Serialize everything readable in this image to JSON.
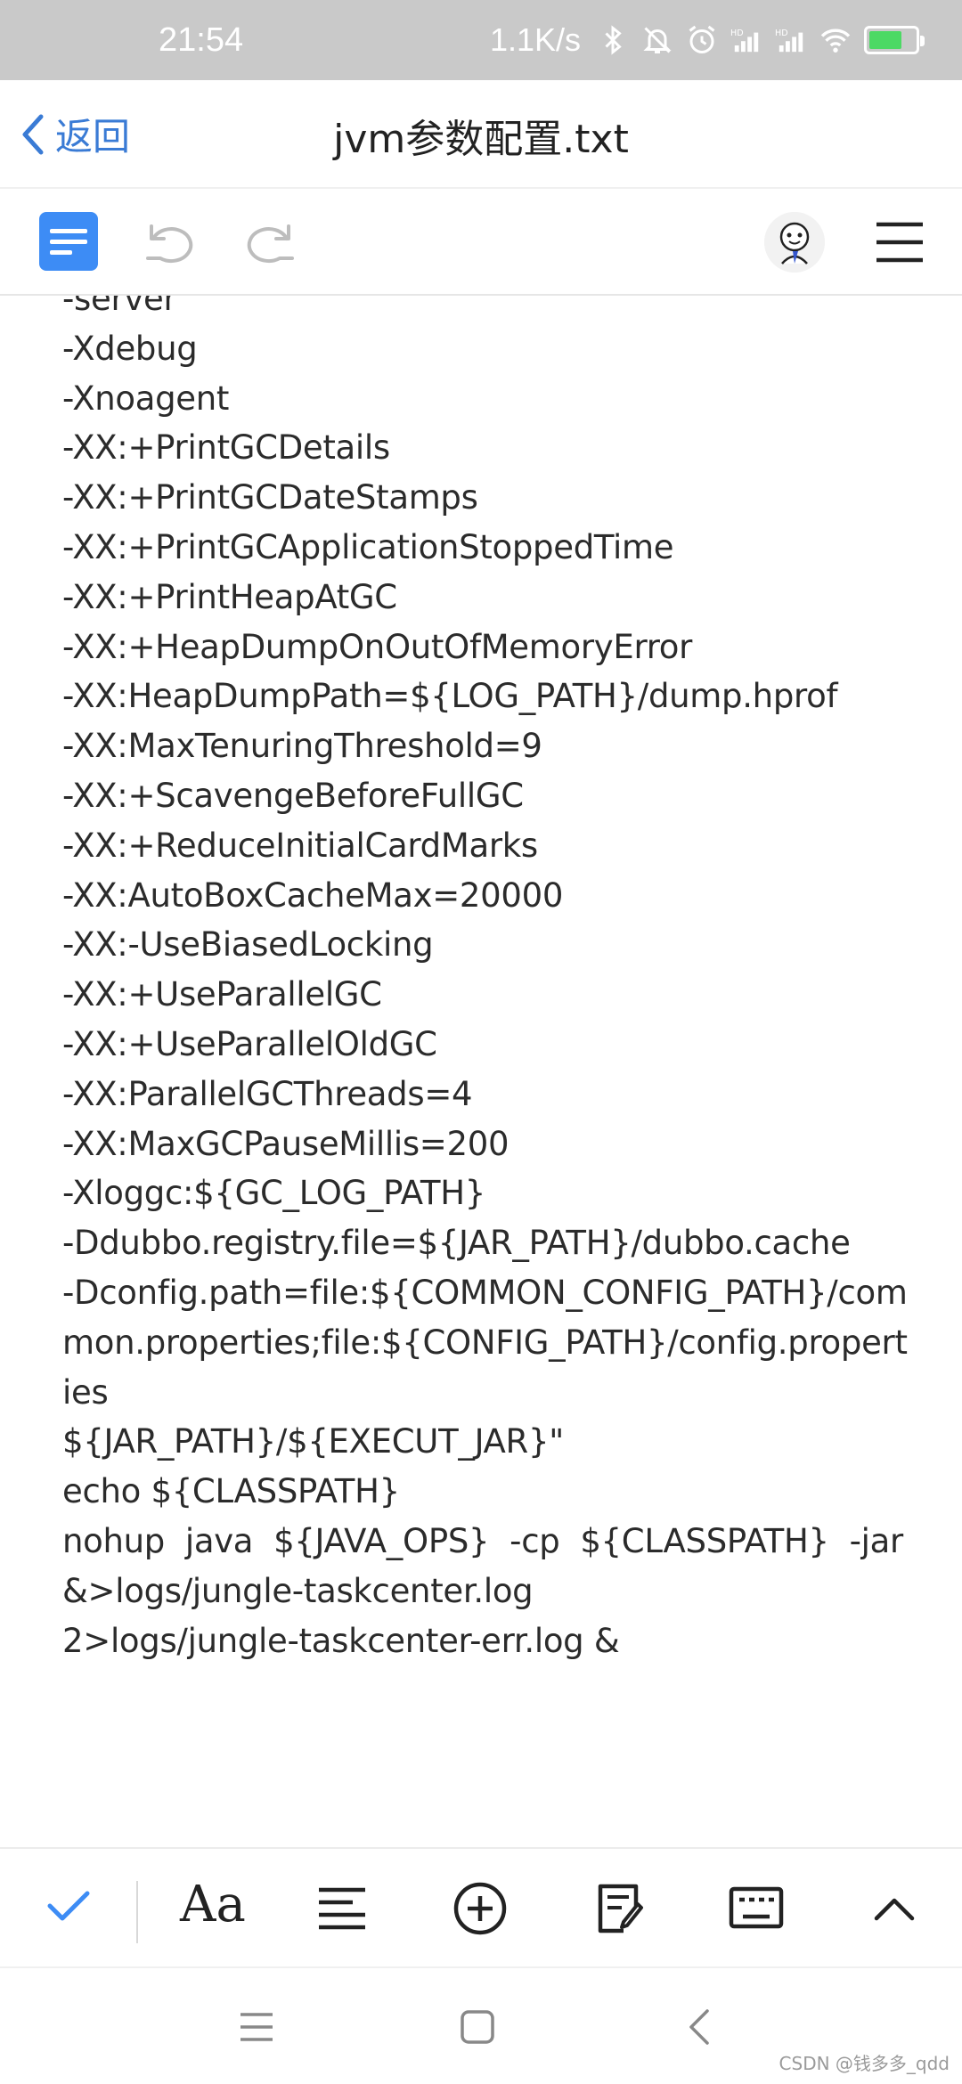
{
  "status_bar": {
    "time": "21:54",
    "net_speed": "1.1K/s",
    "icons": [
      "bluetooth-icon",
      "mute-icon",
      "alarm-icon",
      "hd-signal-icon",
      "hd-signal-icon",
      "wifi-icon",
      "battery-charging-icon"
    ]
  },
  "title_bar": {
    "back_label": "返回",
    "title": "jvm参数配置.txt"
  },
  "toolbar": {
    "icons": [
      "document-icon",
      "undo-icon",
      "redo-icon",
      "avatar-icon",
      "menu-icon"
    ],
    "accent_color": "#3d8cf5"
  },
  "content": {
    "lines": [
      "-server",
      "-Xdebug",
      "-Xnoagent",
      "-XX:+PrintGCDetails",
      "-XX:+PrintGCDateStamps",
      "-XX:+PrintGCApplicationStoppedTime",
      "-XX:+PrintHeapAtGC",
      "-XX:+HeapDumpOnOutOfMemoryError",
      "-XX:HeapDumpPath=${LOG_PATH}/dump.hprof",
      "-XX:MaxTenuringThreshold=9",
      "-XX:+ScavengeBeforeFullGC",
      "-XX:+ReduceInitialCardMarks",
      "-XX:AutoBoxCacheMax=20000",
      "-XX:-UseBiasedLocking",
      "-XX:+UseParallelGC",
      "-XX:+UseParallelOldGC",
      "-XX:ParallelGCThreads=4",
      "-XX:MaxGCPauseMillis=200",
      "-Xloggc:${GC_LOG_PATH}",
      "-Ddubbo.registry.file=${JAR_PATH}/dubbo.cache",
      "-Dconfig.path=file:${COMMON_CONFIG_PATH}/com",
      "mon.properties;file:${CONFIG_PATH}/config.propert",
      "ies",
      "${JAR_PATH}/${EXECUT_JAR}\"",
      "echo ${CLASSPATH}"
    ],
    "justified_line": [
      "nohup",
      "java",
      "${JAVA_OPS}",
      "-cp",
      "${CLASSPATH}",
      "-jar"
    ],
    "tail_lines": [
      "&>logs/jungle-taskcenter.log",
      "2>logs/jungle-taskcenter-err.log &"
    ]
  },
  "bottom_bar": {
    "font_label": "Aa",
    "icons": [
      "check-icon",
      "font-icon",
      "align-left-icon",
      "add-circle-icon",
      "edit-note-icon",
      "keyboard-icon",
      "chevron-up-icon"
    ]
  },
  "nav_bar": {
    "icons": [
      "recent-apps-icon",
      "home-icon",
      "back-icon"
    ]
  },
  "watermark": "CSDN @钱多多_qdd"
}
